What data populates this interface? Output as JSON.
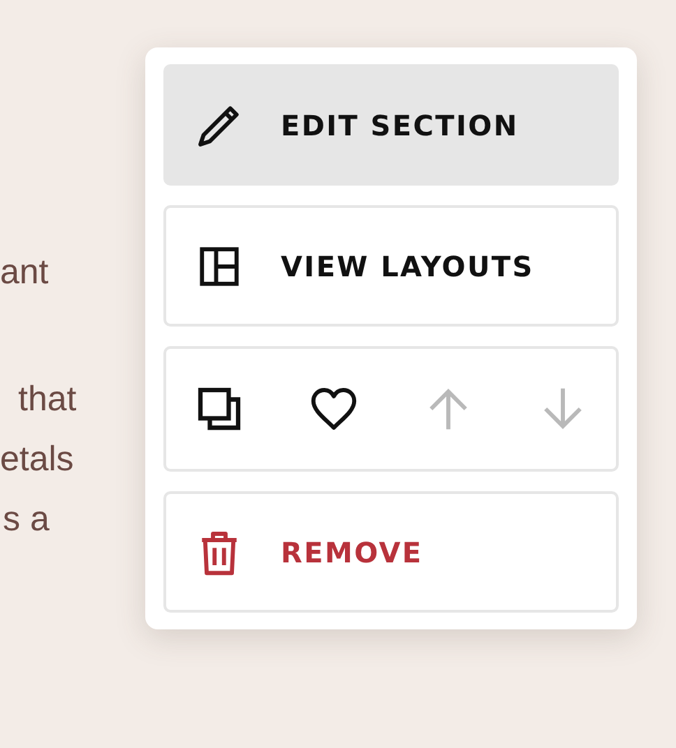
{
  "background_text": [
    "ant",
    "that",
    "etals",
    "s a"
  ],
  "menu": {
    "items": [
      {
        "kind": "action",
        "label": "EDIT SECTION",
        "selected": true
      },
      {
        "kind": "action",
        "label": "VIEW LAYOUTS",
        "selected": false
      },
      {
        "kind": "icon_row",
        "selected": false,
        "buttons": [
          {
            "kind": "duplicate",
            "disabled": false
          },
          {
            "kind": "heart",
            "disabled": false
          },
          {
            "kind": "arrow_up",
            "disabled": true
          },
          {
            "kind": "arrow_down",
            "disabled": true
          }
        ]
      },
      {
        "kind": "danger",
        "label": "REMOVE",
        "selected": false
      }
    ]
  }
}
